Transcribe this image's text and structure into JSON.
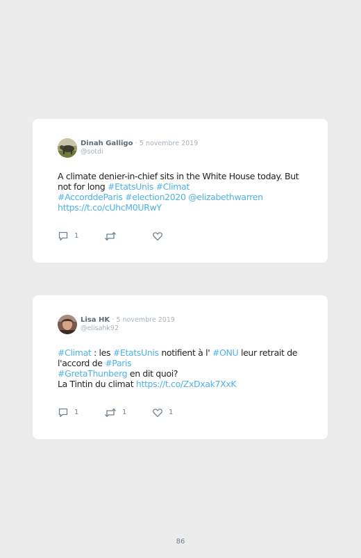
{
  "tweets": [
    {
      "author": "Dinah Galligo",
      "separator": "·",
      "date": "5 novembre 2019",
      "handle": "@sotdi",
      "text": [
        {
          "t": "A climate denier-in-chief sits in the White House today. But not for long ",
          "tag": false
        },
        {
          "t": "#EtatsUnis",
          "tag": true
        },
        {
          "t": " ",
          "tag": false
        },
        {
          "t": "#Climat",
          "tag": true
        },
        {
          "t": "\n",
          "tag": false
        },
        {
          "t": "#AccorddeParis",
          "tag": true
        },
        {
          "t": " ",
          "tag": false
        },
        {
          "t": "#election2020",
          "tag": true
        },
        {
          "t": " ",
          "tag": false
        },
        {
          "t": "@elizabethwarren",
          "tag": true
        },
        {
          "t": "\n",
          "tag": false
        },
        {
          "t": "https://t.co/cUhcM0URwY",
          "tag": true
        }
      ],
      "counts": {
        "replies": "1",
        "retweets": "",
        "likes": ""
      }
    },
    {
      "author": "Lisa HK",
      "separator": "·",
      "date": "5 novembre 2019",
      "handle": "@elisahk92",
      "text": [
        {
          "t": "#Climat",
          "tag": true
        },
        {
          "t": " : les ",
          "tag": false
        },
        {
          "t": "#EtatsUnis",
          "tag": true
        },
        {
          "t": " notifient à l' ",
          "tag": false
        },
        {
          "t": "#ONU",
          "tag": true
        },
        {
          "t": " leur retrait de l'accord de ",
          "tag": false
        },
        {
          "t": "#Paris",
          "tag": true
        },
        {
          "t": "\n",
          "tag": false
        },
        {
          "t": "#GretaThunberg",
          "tag": true
        },
        {
          "t": " en dit quoi?\nLa Tintin du climat ",
          "tag": false
        },
        {
          "t": "https://t.co/ZxDxak7XxK",
          "tag": true
        }
      ],
      "counts": {
        "replies": "1",
        "retweets": "1",
        "likes": "1"
      }
    }
  ],
  "icons": {
    "reply": "speech-bubble-icon",
    "retweet": "retweet-arrows-icon",
    "like": "heart-icon"
  },
  "colors": {
    "background": "#ececec",
    "card": "#ffffff",
    "hashtag": "#4fb2e6",
    "icon": "#6d8193"
  },
  "page_number": "86"
}
